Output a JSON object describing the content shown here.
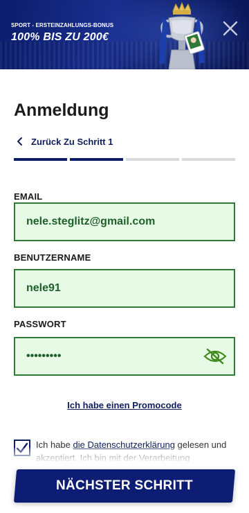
{
  "banner": {
    "subtitle": "SPORT - ERSTEINZAHLUNGS-BONUS",
    "headline": "100% BIS ZU 200€"
  },
  "page": {
    "title": "Anmeldung",
    "back_label": "Zurück Zu Schritt 1"
  },
  "steps": {
    "total": 4,
    "completed": 2
  },
  "form": {
    "email": {
      "label": "EMAIL",
      "value": "nele.steglitz@gmail.com"
    },
    "username": {
      "label": "BENUTZERNAME",
      "value": "nele91"
    },
    "password": {
      "label": "PASSWORT",
      "value": "•••••••••"
    }
  },
  "promo_link": "Ich habe einen Promocode",
  "consent": {
    "checked": true,
    "text_before": "Ich habe ",
    "link_text": "die Datenschutzerklärung",
    "text_after": " gelesen und akzeptiert. Ich bin mit der Verarbeitung"
  },
  "next_button": "NÄCHSTER SCHRITT",
  "colors": {
    "brand_navy": "#0d1d66",
    "field_bg": "#e6fae6",
    "field_border": "#2f7a3a",
    "field_text": "#1f5f2a",
    "step_inactive": "#d9dadd"
  },
  "icons": [
    "close-icon",
    "chevron-left-icon",
    "eye-off-icon",
    "checkmark-icon",
    "trophy-image"
  ]
}
